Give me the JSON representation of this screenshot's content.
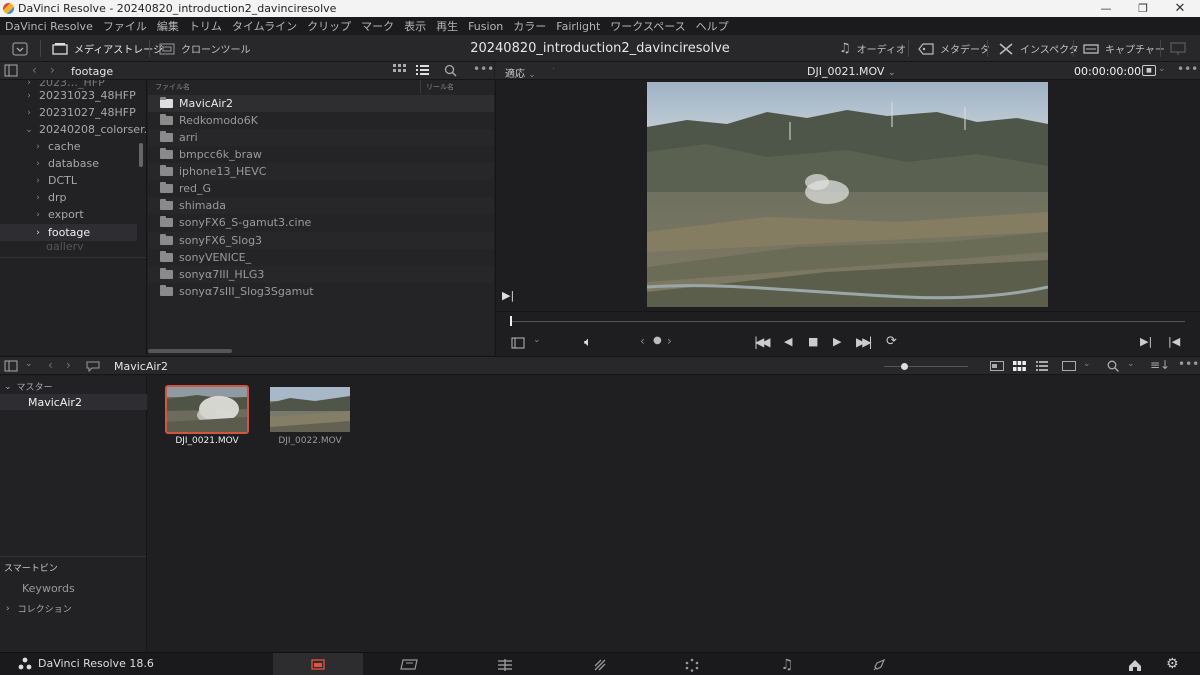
{
  "window": {
    "title": "DaVinci Resolve - 20240820_introduction2_davinciresolve"
  },
  "menu": [
    "DaVinci Resolve",
    "ファイル",
    "編集",
    "トリム",
    "タイムライン",
    "クリップ",
    "マーク",
    "表示",
    "再生",
    "Fusion",
    "カラー",
    "Fairlight",
    "ワークスペース",
    "ヘルプ"
  ],
  "toolbar": {
    "media_storage": "メディアストレージ",
    "clone_tool": "クローンツール",
    "project_title": "20240820_introduction2_davinciresolve",
    "audio": "オーディオ",
    "metadata": "メタデータ",
    "inspector": "インスペクタ",
    "capture": "キャプチャー"
  },
  "storage": {
    "path": "footage",
    "tree": [
      {
        "label": "20231023_48HFP",
        "expanded": false
      },
      {
        "label": "20231027_48HFP",
        "expanded": false
      },
      {
        "label": "20240208_colorser...",
        "expanded": true
      },
      {
        "label": "cache",
        "expanded": false
      },
      {
        "label": "database",
        "expanded": false
      },
      {
        "label": "DCTL",
        "expanded": false
      },
      {
        "label": "drp",
        "expanded": false
      },
      {
        "label": "export",
        "expanded": false
      },
      {
        "label": "footage",
        "expanded": false,
        "selected": true
      }
    ],
    "col_filename": "ファイル名",
    "col_reelname": "リール名",
    "files": [
      "MavicAir2",
      "Redkomodo6K",
      "arri",
      "bmpcc6k_braw",
      "iphone13_HEVC",
      "red_G",
      "shimada",
      "sonyFX6_S-gamut3.cine",
      "sonyFX6_Slog3",
      "sonyVENICE_",
      "sonyα7III_HLG3",
      "sonyα7sIII_Slog3Sgamut"
    ]
  },
  "viewer": {
    "fit": "適応",
    "clip_name": "DJI_0021.MOV",
    "timecode": "00:00:00:00"
  },
  "media_pool": {
    "current_bin": "MavicAir2",
    "master": "マスター",
    "bins": [
      "MavicAir2"
    ],
    "clips": [
      {
        "name": "DJI_0021.MOV",
        "selected": true
      },
      {
        "name": "DJI_0022.MOV",
        "selected": false
      }
    ],
    "smart_bins": "スマートビン",
    "keywords": "Keywords",
    "collections": "コレクション"
  },
  "pagebar": {
    "brand": "DaVinci Resolve 18.6"
  }
}
